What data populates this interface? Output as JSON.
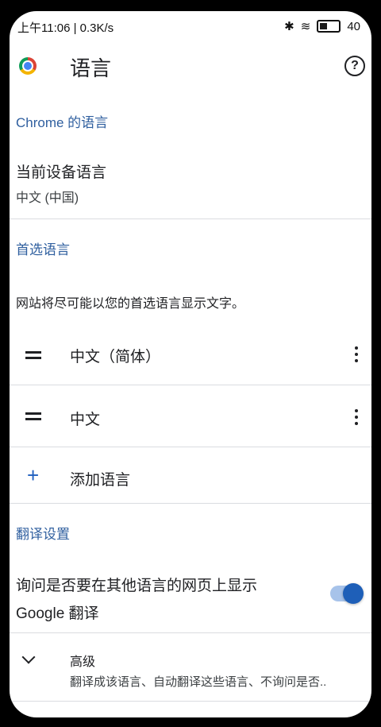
{
  "status": {
    "time_speed": "上午11:06 | 0.3K/s",
    "battery": "40",
    "battery_level": 0.4
  },
  "header": {
    "title": "语言",
    "help_symbol": "?"
  },
  "chrome_languages": {
    "section_title": "Chrome 的语言",
    "device_language_label": "当前设备语言",
    "device_language_value": "中文 (中国)"
  },
  "preferred": {
    "section_title": "首选语言",
    "description": "网站将尽可能以您的首选语言显示文字。",
    "languages": [
      {
        "label": "中文（简体）"
      },
      {
        "label": "中文"
      }
    ],
    "add_label": "添加语言",
    "plus_symbol": "+"
  },
  "translate": {
    "section_title": "翻译设置",
    "offer_line1": "询问是否要在其他语言的网页上显示",
    "offer_line2": "Google 翻译",
    "toggle_on": true,
    "advanced_title": "高级",
    "advanced_subtitle": "翻译成该语言、自动翻译这些语言、不询问是否.."
  },
  "colors": {
    "accent": "#1e5fb8",
    "section_header": "#2f5f9f"
  },
  "icons": [
    "chrome-logo-icon",
    "help-icon",
    "drag-handle-icon",
    "more-vert-icon",
    "add-icon",
    "chevron-down-icon"
  ]
}
